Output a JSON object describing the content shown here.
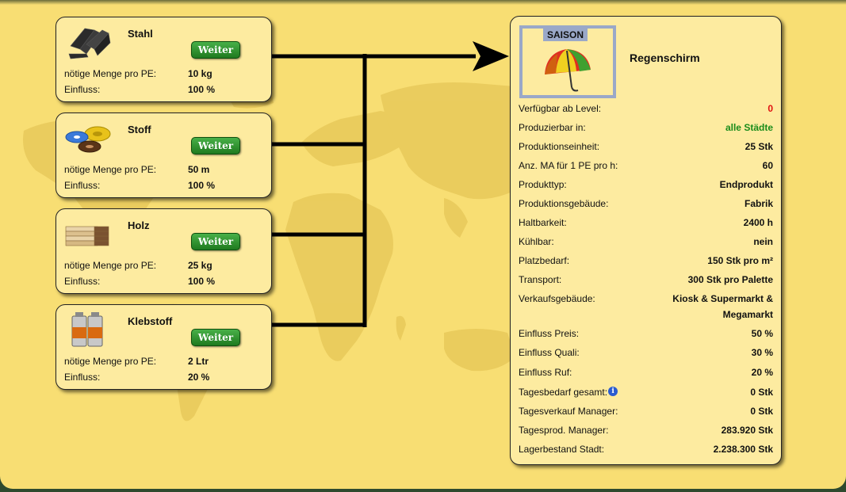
{
  "materials": [
    {
      "name": "Stahl",
      "icon": "steel-beams-icon",
      "button": "Weiter",
      "menge_label": "nötige Menge pro PE:",
      "menge": "10 kg",
      "einfluss_label": "Einfluss:",
      "einfluss": "100 %"
    },
    {
      "name": "Stoff",
      "icon": "fabric-rolls-icon",
      "button": "Weiter",
      "menge_label": "nötige Menge pro PE:",
      "menge": "50 m",
      "einfluss_label": "Einfluss:",
      "einfluss": "100 %"
    },
    {
      "name": "Holz",
      "icon": "wood-planks-icon",
      "button": "Weiter",
      "menge_label": "nötige Menge pro PE:",
      "menge": "25 kg",
      "einfluss_label": "Einfluss:",
      "einfluss": "100 %"
    },
    {
      "name": "Klebstoff",
      "icon": "glue-cans-icon",
      "button": "Weiter",
      "menge_label": "nötige Menge pro PE:",
      "menge": "2 Ltr",
      "einfluss_label": "Einfluss:",
      "einfluss": "20 %"
    }
  ],
  "product": {
    "badge": "SAISON",
    "title": "Regenschirm",
    "icon": "umbrella-icon",
    "rows": [
      {
        "label": "Verfügbar ab Level:",
        "value": "0"
      },
      {
        "label": "Produzierbar in:",
        "value": "alle Städte"
      },
      {
        "label": "Produktionseinheit:",
        "value": "25 Stk"
      },
      {
        "label": "Anz. MA für 1 PE pro h:",
        "value": "60"
      },
      {
        "label": "Produkttyp:",
        "value": "Endprodukt"
      },
      {
        "label": "Produktionsgebäude:",
        "value": "Fabrik"
      },
      {
        "label": "Haltbarkeit:",
        "value": "2400 h"
      },
      {
        "label": "Kühlbar:",
        "value": "nein"
      },
      {
        "label": "Platzbedarf:",
        "value": "150 Stk pro m²"
      },
      {
        "label": "Transport:",
        "value": "300 Stk pro Palette"
      },
      {
        "label": "Verkaufsgebäude:",
        "value": "Kiosk & Supermarkt &",
        "value2": "Megamarkt"
      },
      {
        "label": "Einfluss Preis:",
        "value": "50 %"
      },
      {
        "label": "Einfluss Quali:",
        "value": "30 %"
      },
      {
        "label": "Einfluss Ruf:",
        "value": "20 %"
      },
      {
        "label": "Tagesbedarf gesamt:",
        "value": "0 Stk",
        "info": "i"
      },
      {
        "label": "Tagesverkauf Manager:",
        "value": "0 Stk"
      },
      {
        "label": "Tagesprod. Manager:",
        "value": "283.920 Stk"
      },
      {
        "label": "Lagerbestand Stadt:",
        "value": "2.238.300 Stk"
      }
    ]
  },
  "colors": {
    "background": "#f8de73",
    "card": "#fdeba0",
    "button": "#2e8f2e",
    "highlight_red": "#e01010",
    "highlight_green": "#1a8c1a",
    "frame": "#9aa8c8"
  }
}
